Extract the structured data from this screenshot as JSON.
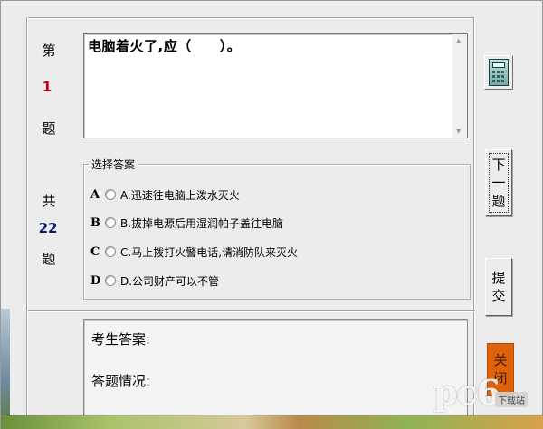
{
  "sidebar": {
    "q_prefix": "第",
    "q_number": "1",
    "q_suffix": "题",
    "total_prefix": "共",
    "total_number": "22",
    "total_suffix": "题"
  },
  "question": {
    "text": "电脑着火了,应（　　）。"
  },
  "options_group": {
    "legend": "选择答案",
    "options": [
      {
        "letter": "A",
        "label": "A.迅速往电脑上泼水灭火"
      },
      {
        "letter": "B",
        "label": "B.拔掉电源后用湿润帕子盖往电脑"
      },
      {
        "letter": "C",
        "label": "C.马上拨打火警电话,请消防队来灭火"
      },
      {
        "letter": "D",
        "label": "D.公司财产可以不管"
      }
    ]
  },
  "answer_panel": {
    "candidate_answer_label": "考生答案:",
    "status_label": "答题情况:"
  },
  "buttons": {
    "next_chars": [
      "下",
      "一",
      "题"
    ],
    "submit_chars": [
      "提",
      "交"
    ],
    "close_chars": [
      "关",
      "闭"
    ],
    "calculator_icon": "calculator-icon"
  },
  "watermark": {
    "logo": "pc6",
    "sub": "下载站"
  },
  "colors": {
    "question_number": "#c00000",
    "total_number": "#10206a",
    "close_button": "#e0600c"
  }
}
